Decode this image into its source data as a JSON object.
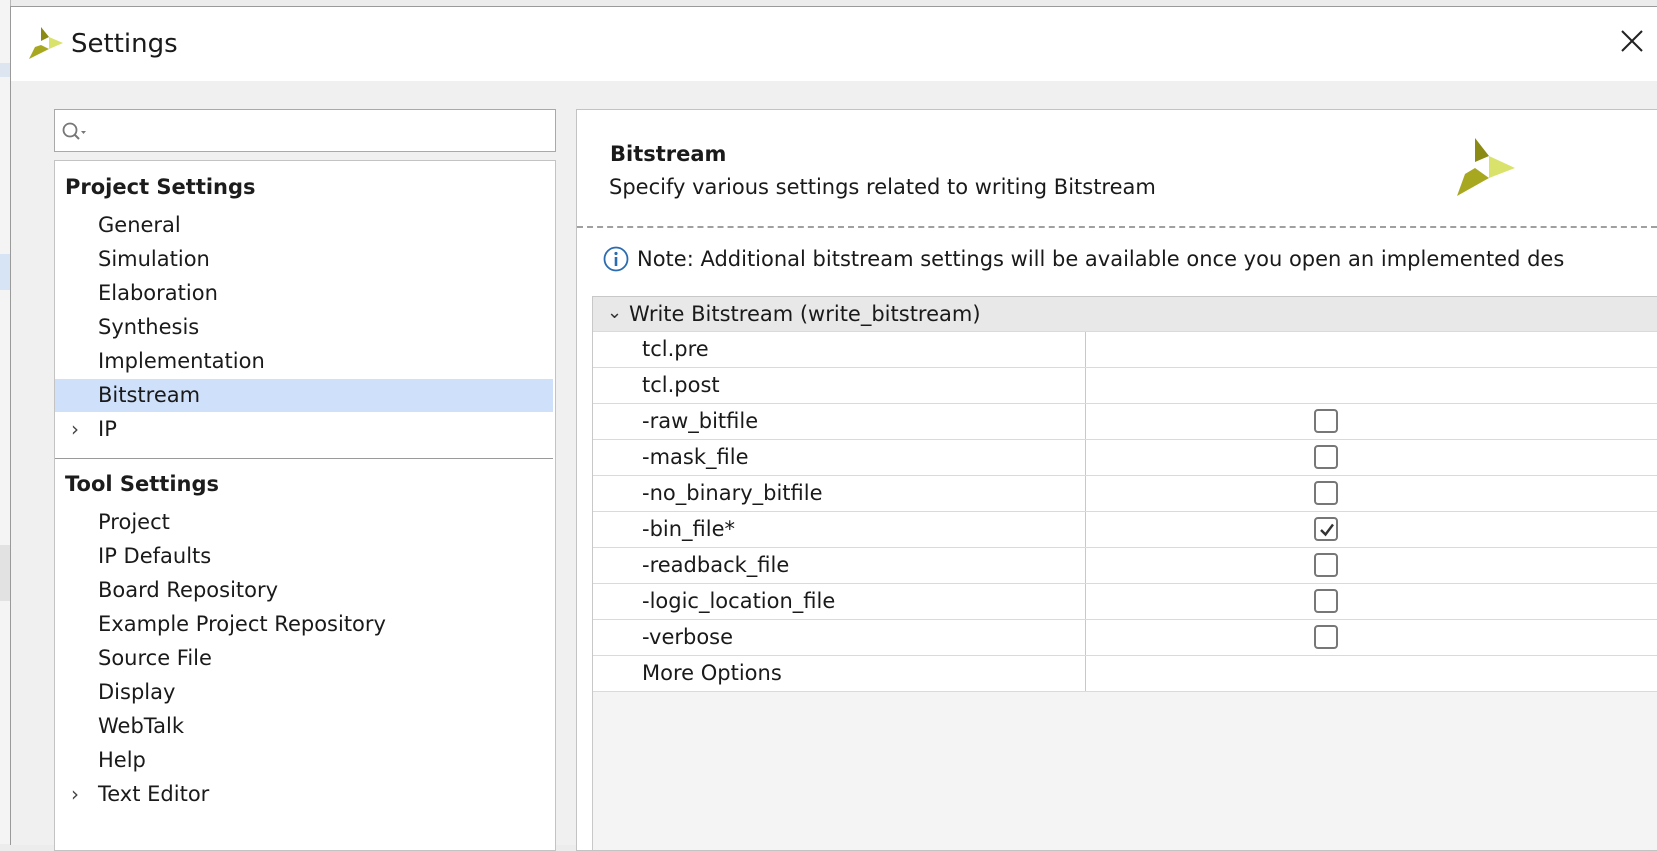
{
  "window": {
    "title": "Settings"
  },
  "search": {
    "value": "",
    "placeholder": ""
  },
  "nav": {
    "project_header": "Project Settings",
    "project_items": [
      {
        "label": "General"
      },
      {
        "label": "Simulation"
      },
      {
        "label": "Elaboration"
      },
      {
        "label": "Synthesis"
      },
      {
        "label": "Implementation"
      },
      {
        "label": "Bitstream",
        "selected": true
      },
      {
        "label": "IP",
        "expandable": true
      }
    ],
    "tool_header": "Tool Settings",
    "tool_items": [
      {
        "label": "Project"
      },
      {
        "label": "IP Defaults"
      },
      {
        "label": "Board Repository"
      },
      {
        "label": "Example Project Repository"
      },
      {
        "label": "Source File"
      },
      {
        "label": "Display"
      },
      {
        "label": "WebTalk"
      },
      {
        "label": "Help"
      },
      {
        "label": "Text Editor",
        "expandable": true
      }
    ]
  },
  "main": {
    "title": "Bitstream",
    "description": "Specify various settings related to writing Bitstream",
    "note": "Note: Additional bitstream settings will be available once you open an implemented des",
    "group": "Write Bitstream (write_bitstream)",
    "options": [
      {
        "name": "tcl.pre",
        "type": "text",
        "value": ""
      },
      {
        "name": "tcl.post",
        "type": "text",
        "value": ""
      },
      {
        "name": "-raw_bitfile",
        "type": "checkbox",
        "checked": false
      },
      {
        "name": "-mask_file",
        "type": "checkbox",
        "checked": false
      },
      {
        "name": "-no_binary_bitfile",
        "type": "checkbox",
        "checked": false
      },
      {
        "name": "-bin_file*",
        "type": "checkbox",
        "checked": true
      },
      {
        "name": "-readback_file",
        "type": "checkbox",
        "checked": false
      },
      {
        "name": "-logic_location_file",
        "type": "checkbox",
        "checked": false
      },
      {
        "name": "-verbose",
        "type": "checkbox",
        "checked": false
      },
      {
        "name": "More Options",
        "type": "text",
        "value": ""
      }
    ]
  },
  "colors": {
    "selection": "#cfe0fa",
    "logo_dark": "#8a8a14",
    "logo_light": "#d9e26a"
  }
}
